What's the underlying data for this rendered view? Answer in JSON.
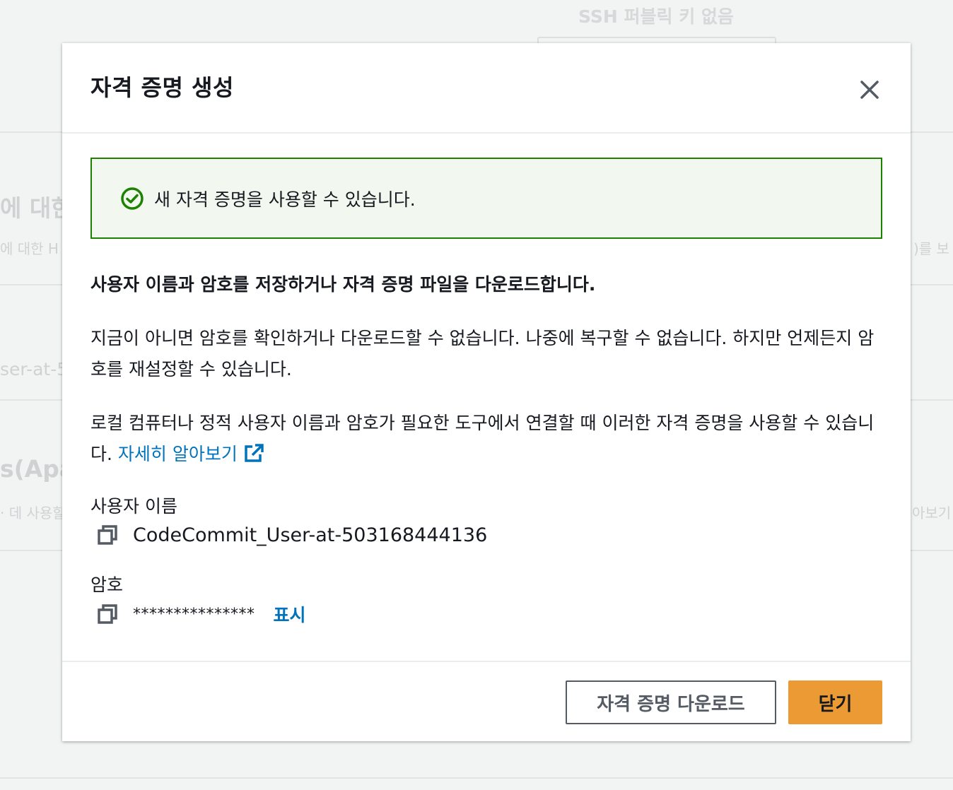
{
  "background": {
    "ssh_text": "SSH 퍼블릭 키 없음",
    "heading1": "에 대한",
    "sub1": "에 대한 H",
    "right1": ")를 보",
    "user_fragment": "ser-at-5",
    "heading2": "s(Apa",
    "sub2": "· 데 사용할",
    "right2": "아보기"
  },
  "modal": {
    "title": "자격 증명 생성",
    "alert": {
      "type": "success",
      "text": "새 자격 증명을 사용할 수 있습니다."
    },
    "instruction": "사용자 이름과 암호를 저장하거나 자격 증명 파일을 다운로드합니다.",
    "warning": "지금이 아니면 암호를 확인하거나 다운로드할 수 없습니다. 나중에 복구할 수 없습니다. 하지만 언제든지 암호를 재설정할 수 있습니다.",
    "usage_text": "로컬 컴퓨터나 정적 사용자 이름과 암호가 필요한 도구에서 연결할 때 이러한 자격 증명을 사용할 수 있습니다.",
    "learn_more": "자세히 알아보기",
    "username_label": "사용자 이름",
    "username_value": "CodeCommit_User-at-503168444136",
    "password_label": "암호",
    "password_mask": "***************",
    "show_label": "표시",
    "download_button": "자격 증명 다운로드",
    "close_button": "닫기"
  },
  "icons": {
    "close": "close-icon",
    "success": "check-circle-icon",
    "external": "external-link-icon",
    "copy": "copy-icon"
  },
  "colors": {
    "success": "#1d8102",
    "link": "#0073bb",
    "primary_button": "#ec9a34"
  }
}
